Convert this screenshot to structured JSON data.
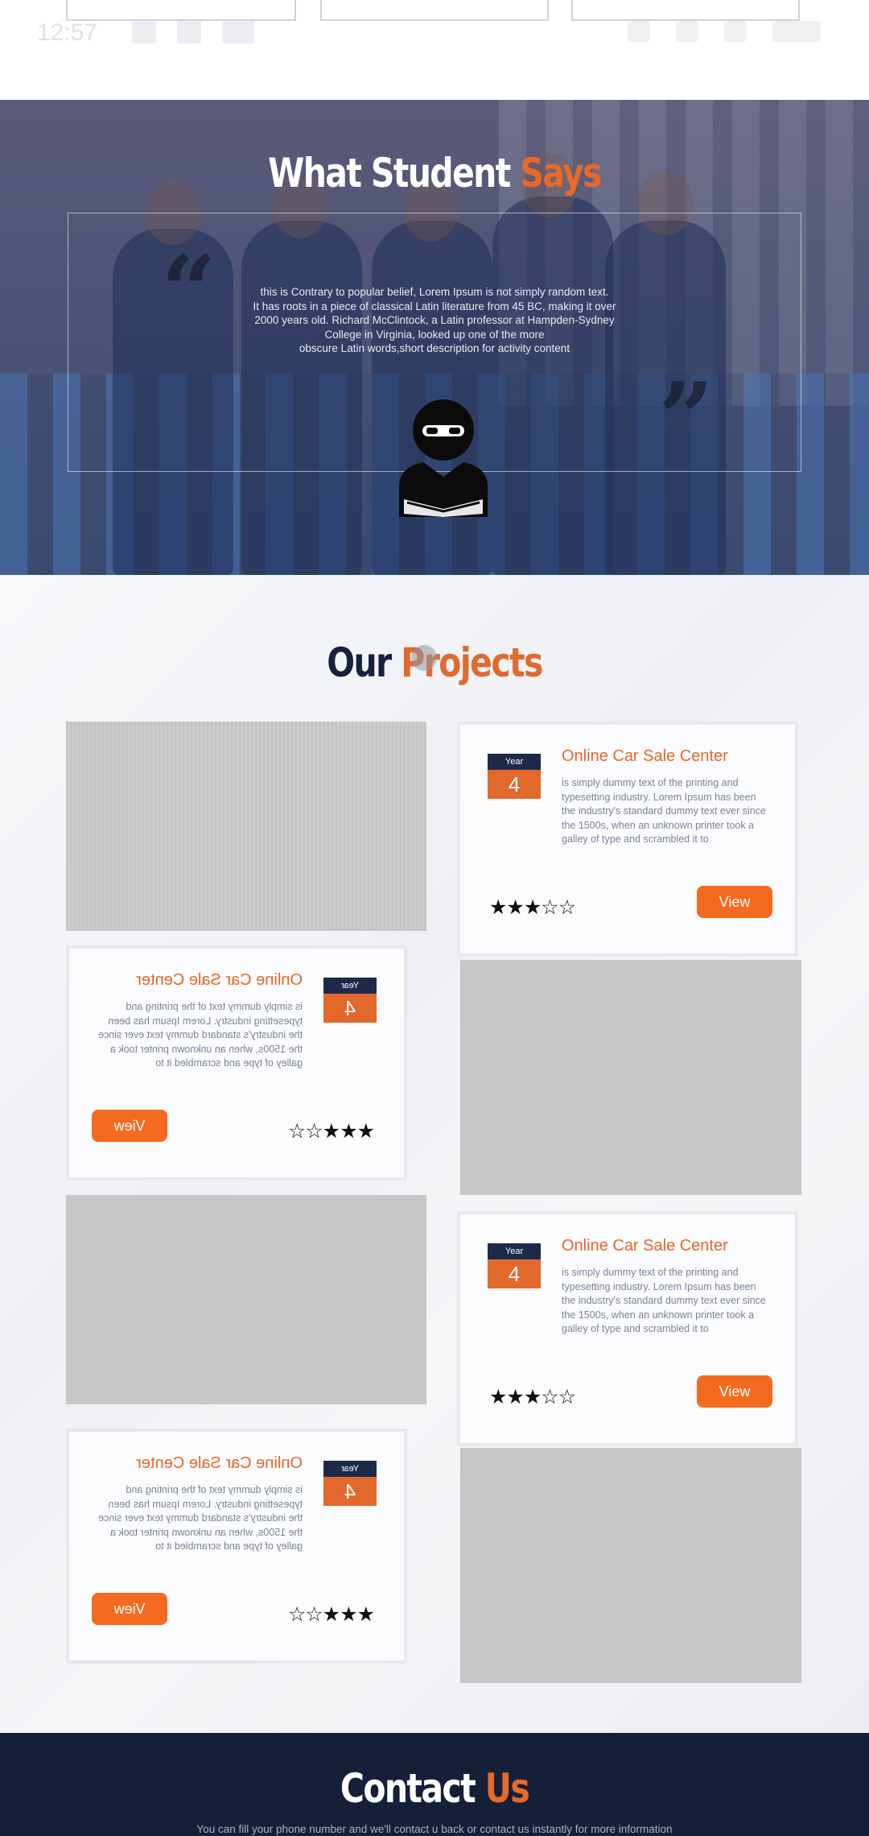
{
  "status_bar": {
    "time": "12:57"
  },
  "testimonial": {
    "heading_white": "What Student ",
    "heading_orange": "Says",
    "quote_lines": [
      "this is Contrary to popular belief, Lorem Ipsum is not simply random text.",
      "It has roots in a piece of classical Latin literature from 45 BC, making it over",
      "2000 years old. Richard McClintock, a Latin professor at Hampden-Sydney",
      "College in Virginia, looked up one of the more",
      "obscure Latin words,short description for activity content"
    ]
  },
  "projects": {
    "heading_navy": "Our ",
    "heading_orange": "Projects",
    "items": [
      {
        "year_label": "Year",
        "year": "4",
        "title": "Online Car Sale Center",
        "description": "is simply dummy text of the printing and typesetting industry. Lorem Ipsum has been the industry's standard dummy text ever since the 1500s, when an unknown printer took a galley of type and scrambled it to",
        "rating": 3,
        "stars": "★★★☆☆",
        "button": "View"
      },
      {
        "year_label": "Year",
        "year": "4",
        "title": "Online Car Sale Center",
        "description": "is simply dummy text of the printing and typesetting industry. Lorem Ipsum has been the industry's standard dummy text ever since the 1500s, when an unknown printer took a galley of type and scrambled it to",
        "rating": 3,
        "stars": "★★★☆☆",
        "button": "View"
      },
      {
        "year_label": "Year",
        "year": "4",
        "title": "Online Car Sale Center",
        "description": "is simply dummy text of the printing and typesetting industry. Lorem Ipsum has been the industry's standard dummy text ever since the 1500s, when an unknown printer took a galley of type and scrambled it to",
        "rating": 3,
        "stars": "★★★☆☆",
        "button": "View"
      },
      {
        "year_label": "Year",
        "year": "4",
        "title": "Online Car Sale Center",
        "description": "is simply dummy text of the printing and typesetting industry. Lorem Ipsum has been the industry's standard dummy text ever since the 1500s, when an unknown printer took a galley of type and scrambled it to",
        "rating": 3,
        "stars": "★★★☆☆",
        "button": "View"
      }
    ]
  },
  "contact": {
    "heading_white": "Contact ",
    "heading_orange": "Us",
    "subtitle": "You can fill your phone number and we'll contact u back or contact us instantly for more information"
  },
  "colors": {
    "navy": "#15213d",
    "orange": "#e8692a",
    "button": "#f46a1f"
  }
}
